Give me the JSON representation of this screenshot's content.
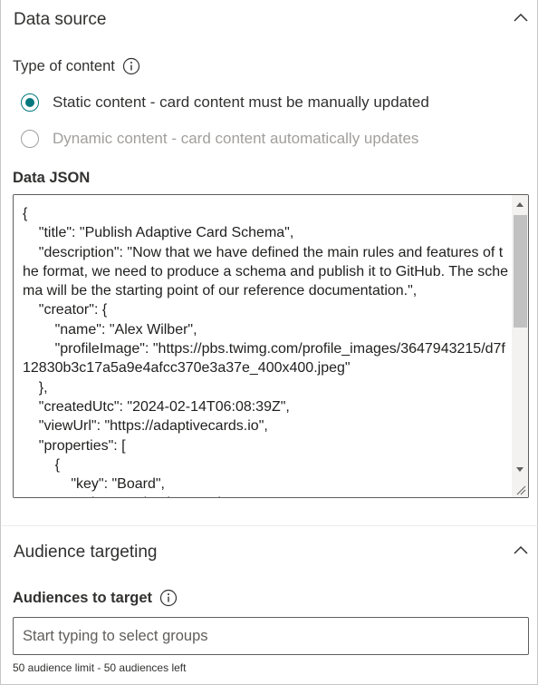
{
  "data_source": {
    "title": "Data source",
    "type_label": "Type of content",
    "options": [
      {
        "label": "Static content - card content must be manually updated",
        "selected": true,
        "disabled": false
      },
      {
        "label": "Dynamic content - card content automatically updates",
        "selected": false,
        "disabled": true
      }
    ],
    "json_label": "Data JSON",
    "json_value": "{\n    \"title\": \"Publish Adaptive Card Schema\",\n    \"description\": \"Now that we have defined the main rules and features of the format, we need to produce a schema and publish it to GitHub. The schema will be the starting point of our reference documentation.\",\n    \"creator\": {\n        \"name\": \"Alex Wilber\",\n        \"profileImage\": \"https://pbs.twimg.com/profile_images/3647943215/d7f12830b3c17a5a9e4afcc370e3a37e_400x400.jpeg\"\n    },\n    \"createdUtc\": \"2024-02-14T06:08:39Z\",\n    \"viewUrl\": \"https://adaptivecards.io\",\n    \"properties\": [\n        {\n            \"key\": \"Board\",\n            \"value\": \"Adaptive Cards\"\n        }\n    ]\n}"
  },
  "audience": {
    "title": "Audience targeting",
    "target_label": "Audiences to target",
    "input_placeholder": "Start typing to select groups",
    "limit_text": "50 audience limit - 50 audiences left"
  },
  "colors": {
    "accent": "#03787c",
    "text": "#323130",
    "disabled": "#a19f9d"
  }
}
